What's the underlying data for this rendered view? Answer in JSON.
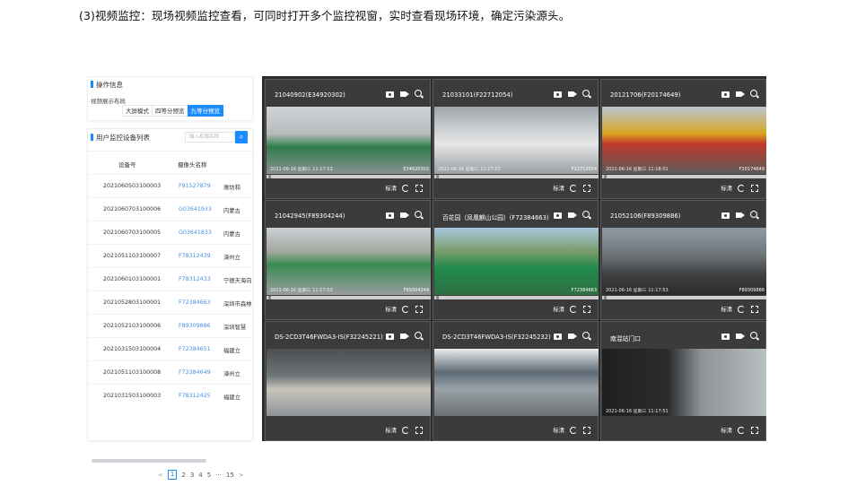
{
  "caption": "(3)视频监控：现场视频监控查看，可同时打开多个监控视窗，实时查看现场环境，确定污染源头。",
  "ops_panel": {
    "title": "操作信息",
    "layout_label": "视频展示布局",
    "buttons": [
      "大屏模式",
      "四等分预览",
      "九等分预览"
    ],
    "active_index": 2
  },
  "device_panel": {
    "title": "用户监控设备列表",
    "search_placeholder": "输入权限名称",
    "columns": [
      "设备号",
      "摄像头名称"
    ],
    "rows": [
      {
        "device": "2021060503100003",
        "camera": "F91527879",
        "area": "潍坊和"
      },
      {
        "device": "2021060703100006",
        "camera": "G03641933",
        "area": "内蒙古"
      },
      {
        "device": "2021060703100005",
        "camera": "G03641833",
        "area": "内蒙古"
      },
      {
        "device": "2021051103100007",
        "camera": "F78312439",
        "area": "漳州立"
      },
      {
        "device": "2021060103100001",
        "camera": "F78312433",
        "area": "宁德天海向"
      },
      {
        "device": "2021052803100001",
        "camera": "F72384663",
        "area": "深圳市森林"
      },
      {
        "device": "2021052103100006",
        "camera": "F89309886",
        "area": "深圳智慧"
      },
      {
        "device": "2021031503100004",
        "camera": "F72384651",
        "area": "福建立"
      },
      {
        "device": "2021051103100008",
        "camera": "F72384649",
        "area": "漳州立"
      },
      {
        "device": "2021031503100003",
        "camera": "F78312425",
        "area": "福建立"
      }
    ],
    "pager": {
      "prev": "<",
      "pages": [
        "1",
        "2",
        "3",
        "4",
        "5",
        "···",
        "15"
      ],
      "next": ">",
      "current": "1"
    }
  },
  "cameras": [
    {
      "title": "21040902(E34920302)",
      "ts": "2021-06-16 星期三 11:17:53",
      "code": "E34920302",
      "scene": "site-gray"
    },
    {
      "title": "21033101(F22712054)",
      "ts": "2021-06-16 星期三 11:17:53",
      "code": "F22712054",
      "scene": "fence"
    },
    {
      "title": "20121706(F20174649)",
      "ts": "2021-06-16 星期三 11:18:01",
      "code": "F20174649",
      "scene": "crane"
    },
    {
      "title": "21042945(F89304244)",
      "ts": "2021-06-16 星期三 11:17:53",
      "code": "F89304244",
      "scene": "site-wide"
    },
    {
      "title": "百花园（凤凰麒山公园）(F72384663)",
      "ts": "",
      "code": "F72384663",
      "scene": "green-net"
    },
    {
      "title": "21052106(F89309886)",
      "ts": "2021-06-16 星期三 11:17:53",
      "code": "F89309886",
      "scene": "road"
    },
    {
      "title": "DS-2CD3T46FWDA3-IS(F32245221)",
      "ts": "",
      "code": "",
      "scene": "truck"
    },
    {
      "title": "DS-2CD3T46FWDA3-IS(F32245232)",
      "ts": "",
      "code": "",
      "scene": "shed"
    },
    {
      "title": "南混站门口",
      "ts": "2021-06-16 星期三 11:17:51",
      "code": "",
      "scene": "gate"
    }
  ],
  "tile_controls": {
    "label": "标清"
  }
}
